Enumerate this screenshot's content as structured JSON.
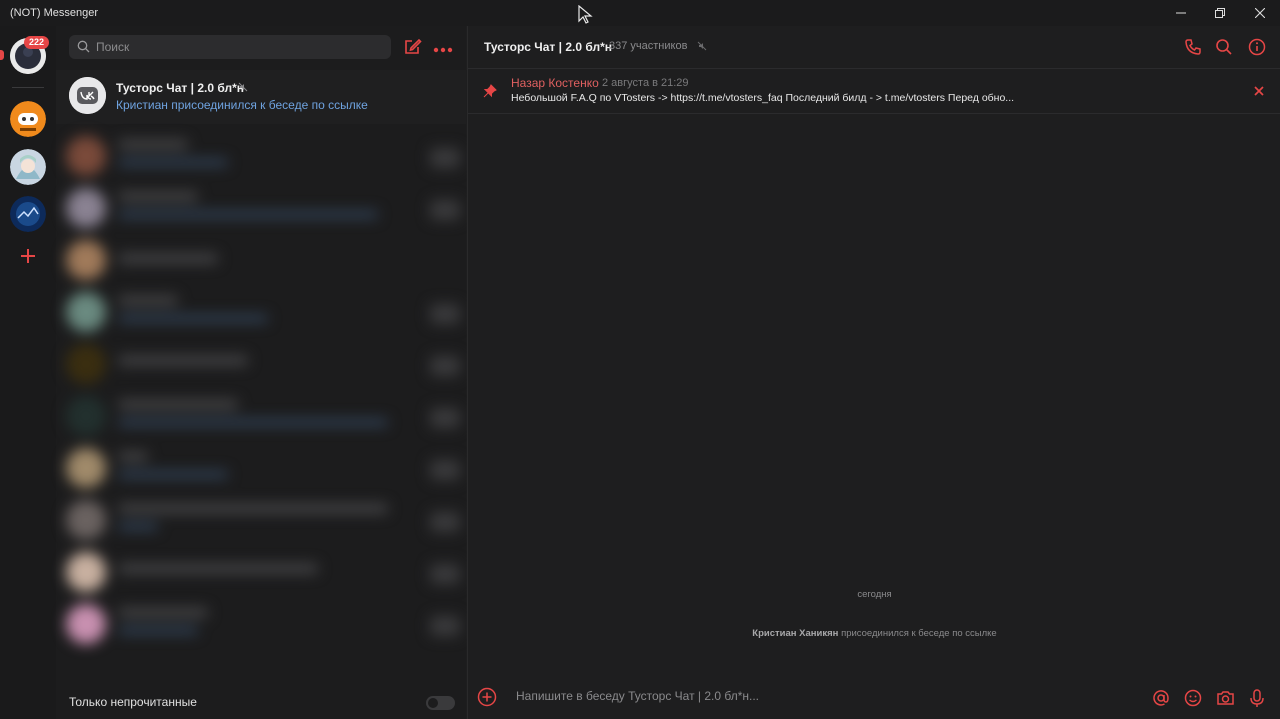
{
  "window": {
    "title": "(NOT) Messenger"
  },
  "colors": {
    "accent": "#e64646",
    "link": "#6fa3e0",
    "bg": "#1e1e1f"
  },
  "rail": {
    "badge_count": "222",
    "icons": [
      "avatar",
      "vtosters-mascot",
      "anime-avatar",
      "space-avatar",
      "plus-icon"
    ]
  },
  "list": {
    "search_placeholder": "Поиск",
    "active_chat": {
      "name": "Тусторс Чат | 2.0 бл*н",
      "preview": "Кристиан присоединился к беседе по ссылке"
    },
    "unread_only_label": "Только непрочитанные",
    "unread_only_enabled": false
  },
  "conversation": {
    "title": "Тусторс Чат | 2.0 бл*н",
    "members": "337 участников",
    "pinned": {
      "author": "Назар Костенко",
      "date": "2 августа в 21:29",
      "text": "Небольшой F.A.Q по VTosters -> https://t.me/vtosters_faq Последний билд - > t.me/vtosters Перед обно..."
    },
    "day_label": "сегодня",
    "system_message": {
      "user": "Кристиан Ханикян",
      "action": "присоединился к беседе по ссылке"
    },
    "composer_placeholder": "Напишите в беседу Тусторс Чат | 2.0 бл*н..."
  }
}
